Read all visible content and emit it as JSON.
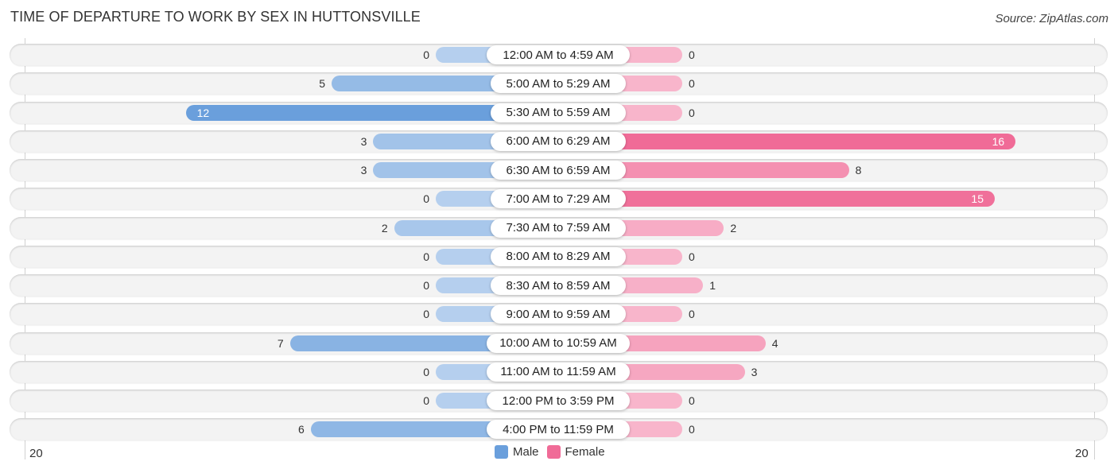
{
  "chart_data": {
    "type": "bar",
    "orientation": "horizontal-diverging",
    "title": "TIME OF DEPARTURE TO WORK BY SEX IN HUTTONSVILLE",
    "source": "Source: ZipAtlas.com",
    "categories": [
      "12:00 AM to 4:59 AM",
      "5:00 AM to 5:29 AM",
      "5:30 AM to 5:59 AM",
      "6:00 AM to 6:29 AM",
      "6:30 AM to 6:59 AM",
      "7:00 AM to 7:29 AM",
      "7:30 AM to 7:59 AM",
      "8:00 AM to 8:29 AM",
      "8:30 AM to 8:59 AM",
      "9:00 AM to 9:59 AM",
      "10:00 AM to 10:59 AM",
      "11:00 AM to 11:59 AM",
      "12:00 PM to 3:59 PM",
      "4:00 PM to 11:59 PM"
    ],
    "series": [
      {
        "name": "Male",
        "color": "#6a9fdc",
        "values": [
          0,
          5,
          12,
          3,
          3,
          0,
          2,
          0,
          0,
          0,
          7,
          0,
          0,
          6
        ]
      },
      {
        "name": "Female",
        "color": "#f06b97",
        "values": [
          0,
          0,
          0,
          16,
          8,
          15,
          2,
          0,
          1,
          0,
          4,
          3,
          0,
          0
        ]
      }
    ],
    "axis": {
      "left_label": "20",
      "right_label": "20",
      "max": 20
    },
    "legend": {
      "position": "bottom-center",
      "items": [
        "Male",
        "Female"
      ]
    }
  }
}
